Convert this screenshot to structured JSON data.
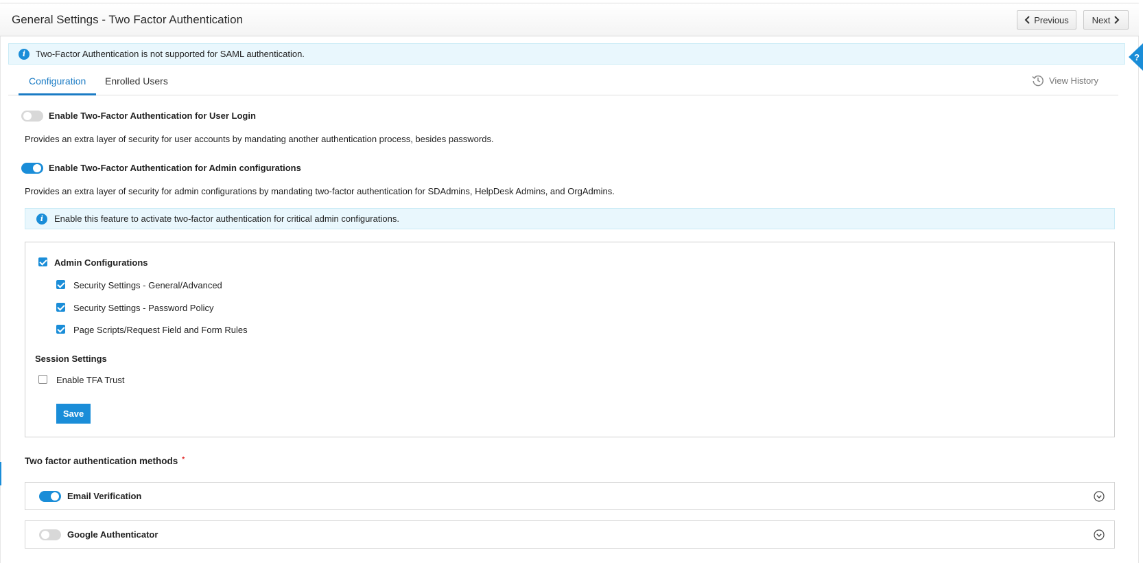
{
  "header": {
    "title": "General Settings - Two Factor Authentication",
    "previous_label": "Previous",
    "next_label": "Next"
  },
  "banner": {
    "text": "Two-Factor Authentication is not supported for SAML authentication."
  },
  "tabs": [
    {
      "label": "Configuration",
      "active": true
    },
    {
      "label": "Enrolled Users",
      "active": false
    }
  ],
  "view_history_label": "View History",
  "user_login": {
    "label": "Enable Two-Factor Authentication for User Login",
    "enabled": false,
    "description": "Provides an extra layer of security for user accounts by mandating another authentication process, besides passwords."
  },
  "admin_config": {
    "label": "Enable Two-Factor Authentication for Admin configurations",
    "enabled": true,
    "description": "Provides an extra layer of security for admin configurations by mandating two-factor authentication for SDAdmins, HelpDesk Admins, and OrgAdmins.",
    "info_text": "Enable this feature to activate two-factor authentication for critical admin configurations."
  },
  "config_box": {
    "parent": {
      "label": "Admin Configurations",
      "checked": true
    },
    "children": [
      {
        "label": "Security Settings - General/Advanced",
        "checked": true
      },
      {
        "label": "Security Settings - Password Policy",
        "checked": true
      },
      {
        "label": "Page Scripts/Request Field and Form Rules",
        "checked": true
      }
    ],
    "session_title": "Session Settings",
    "tfa_trust": {
      "label": "Enable TFA Trust",
      "checked": false
    },
    "save_label": "Save"
  },
  "methods": {
    "title": "Two factor authentication methods",
    "required_mark": "*",
    "items": [
      {
        "label": "Email Verification",
        "enabled": true
      },
      {
        "label": "Google Authenticator",
        "enabled": false
      }
    ]
  },
  "colors": {
    "accent": "#1a8dd8",
    "tab_active": "#1a7bc4",
    "info_bg": "#e9f7fd",
    "toggle_off": "#d8d8d8"
  },
  "icons": [
    "chevron-left-icon",
    "chevron-right-icon",
    "help-icon",
    "info-icon",
    "history-icon",
    "chevron-down-circle-icon"
  ]
}
